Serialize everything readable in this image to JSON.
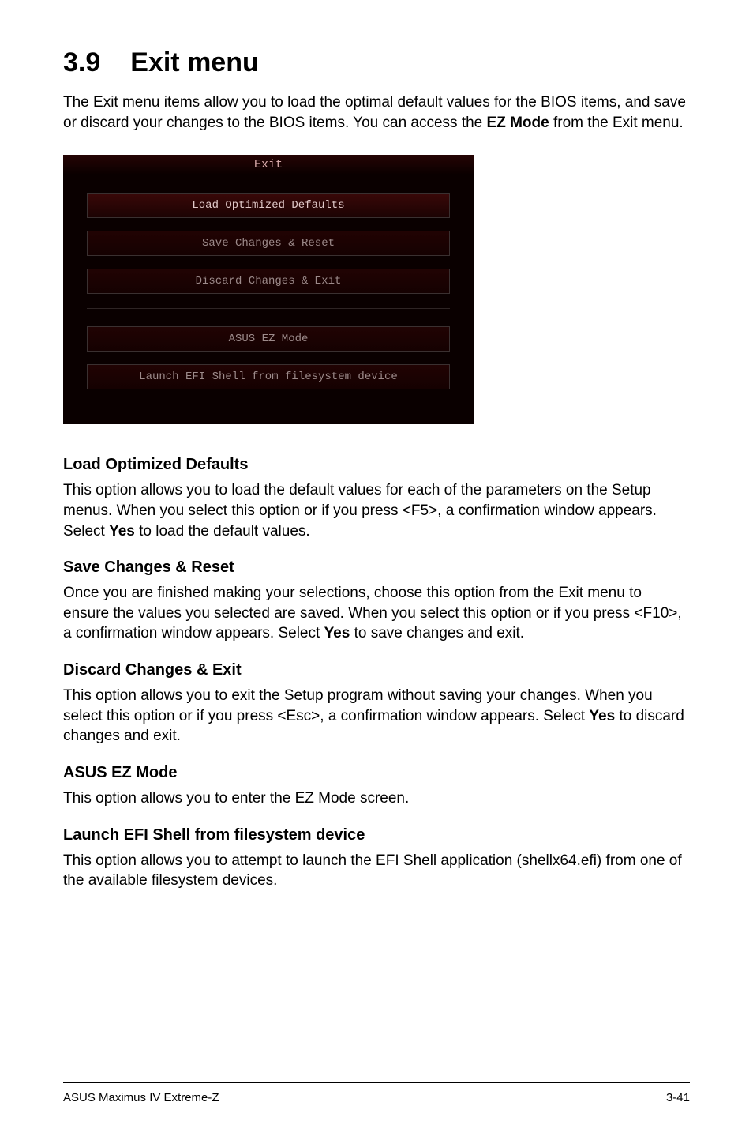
{
  "heading": {
    "num": "3.9",
    "title": "Exit menu"
  },
  "intro": {
    "text1": "The Exit menu items allow you to load the optimal default values for the BIOS items, and save or discard your changes to the BIOS items. You can access the ",
    "bold": "EZ Mode",
    "text2": " from the Exit menu."
  },
  "bios": {
    "header": "Exit",
    "buttons": {
      "load": "Load Optimized Defaults",
      "save": "Save Changes & Reset",
      "discard": "Discard Changes & Exit",
      "ezmode": "ASUS EZ Mode",
      "efi": "Launch EFI Shell from filesystem device"
    }
  },
  "sections": {
    "load": {
      "title": "Load Optimized Defaults",
      "pre": "This option allows you to load the default values for each of the parameters on the Setup menus. When you select this option or if you press <F5>, a confirmation window appears. Select ",
      "bold": "Yes",
      "post": " to load the default values."
    },
    "save": {
      "title": "Save Changes & Reset",
      "pre": "Once you are finished making your selections, choose this option from the Exit menu to ensure the values you selected are saved. When you select this option or if you press <F10>, a confirmation window appears. Select ",
      "bold": "Yes",
      "post": " to save changes and exit."
    },
    "discard": {
      "title": "Discard Changes & Exit",
      "pre": "This option allows you to exit the Setup program without saving your changes. When you select this option or if you press <Esc>, a confirmation window appears. Select ",
      "bold": "Yes",
      "post": " to discard changes and exit."
    },
    "ezmode": {
      "title": "ASUS EZ Mode",
      "body": "This option allows you to enter the EZ Mode screen."
    },
    "efi": {
      "title": "Launch EFI Shell from filesystem device",
      "body": "This option allows you to attempt to launch the EFI Shell application (shellx64.efi) from one of the available filesystem devices."
    }
  },
  "footer": {
    "left": "ASUS Maximus IV Extreme-Z",
    "right": "3-41"
  }
}
